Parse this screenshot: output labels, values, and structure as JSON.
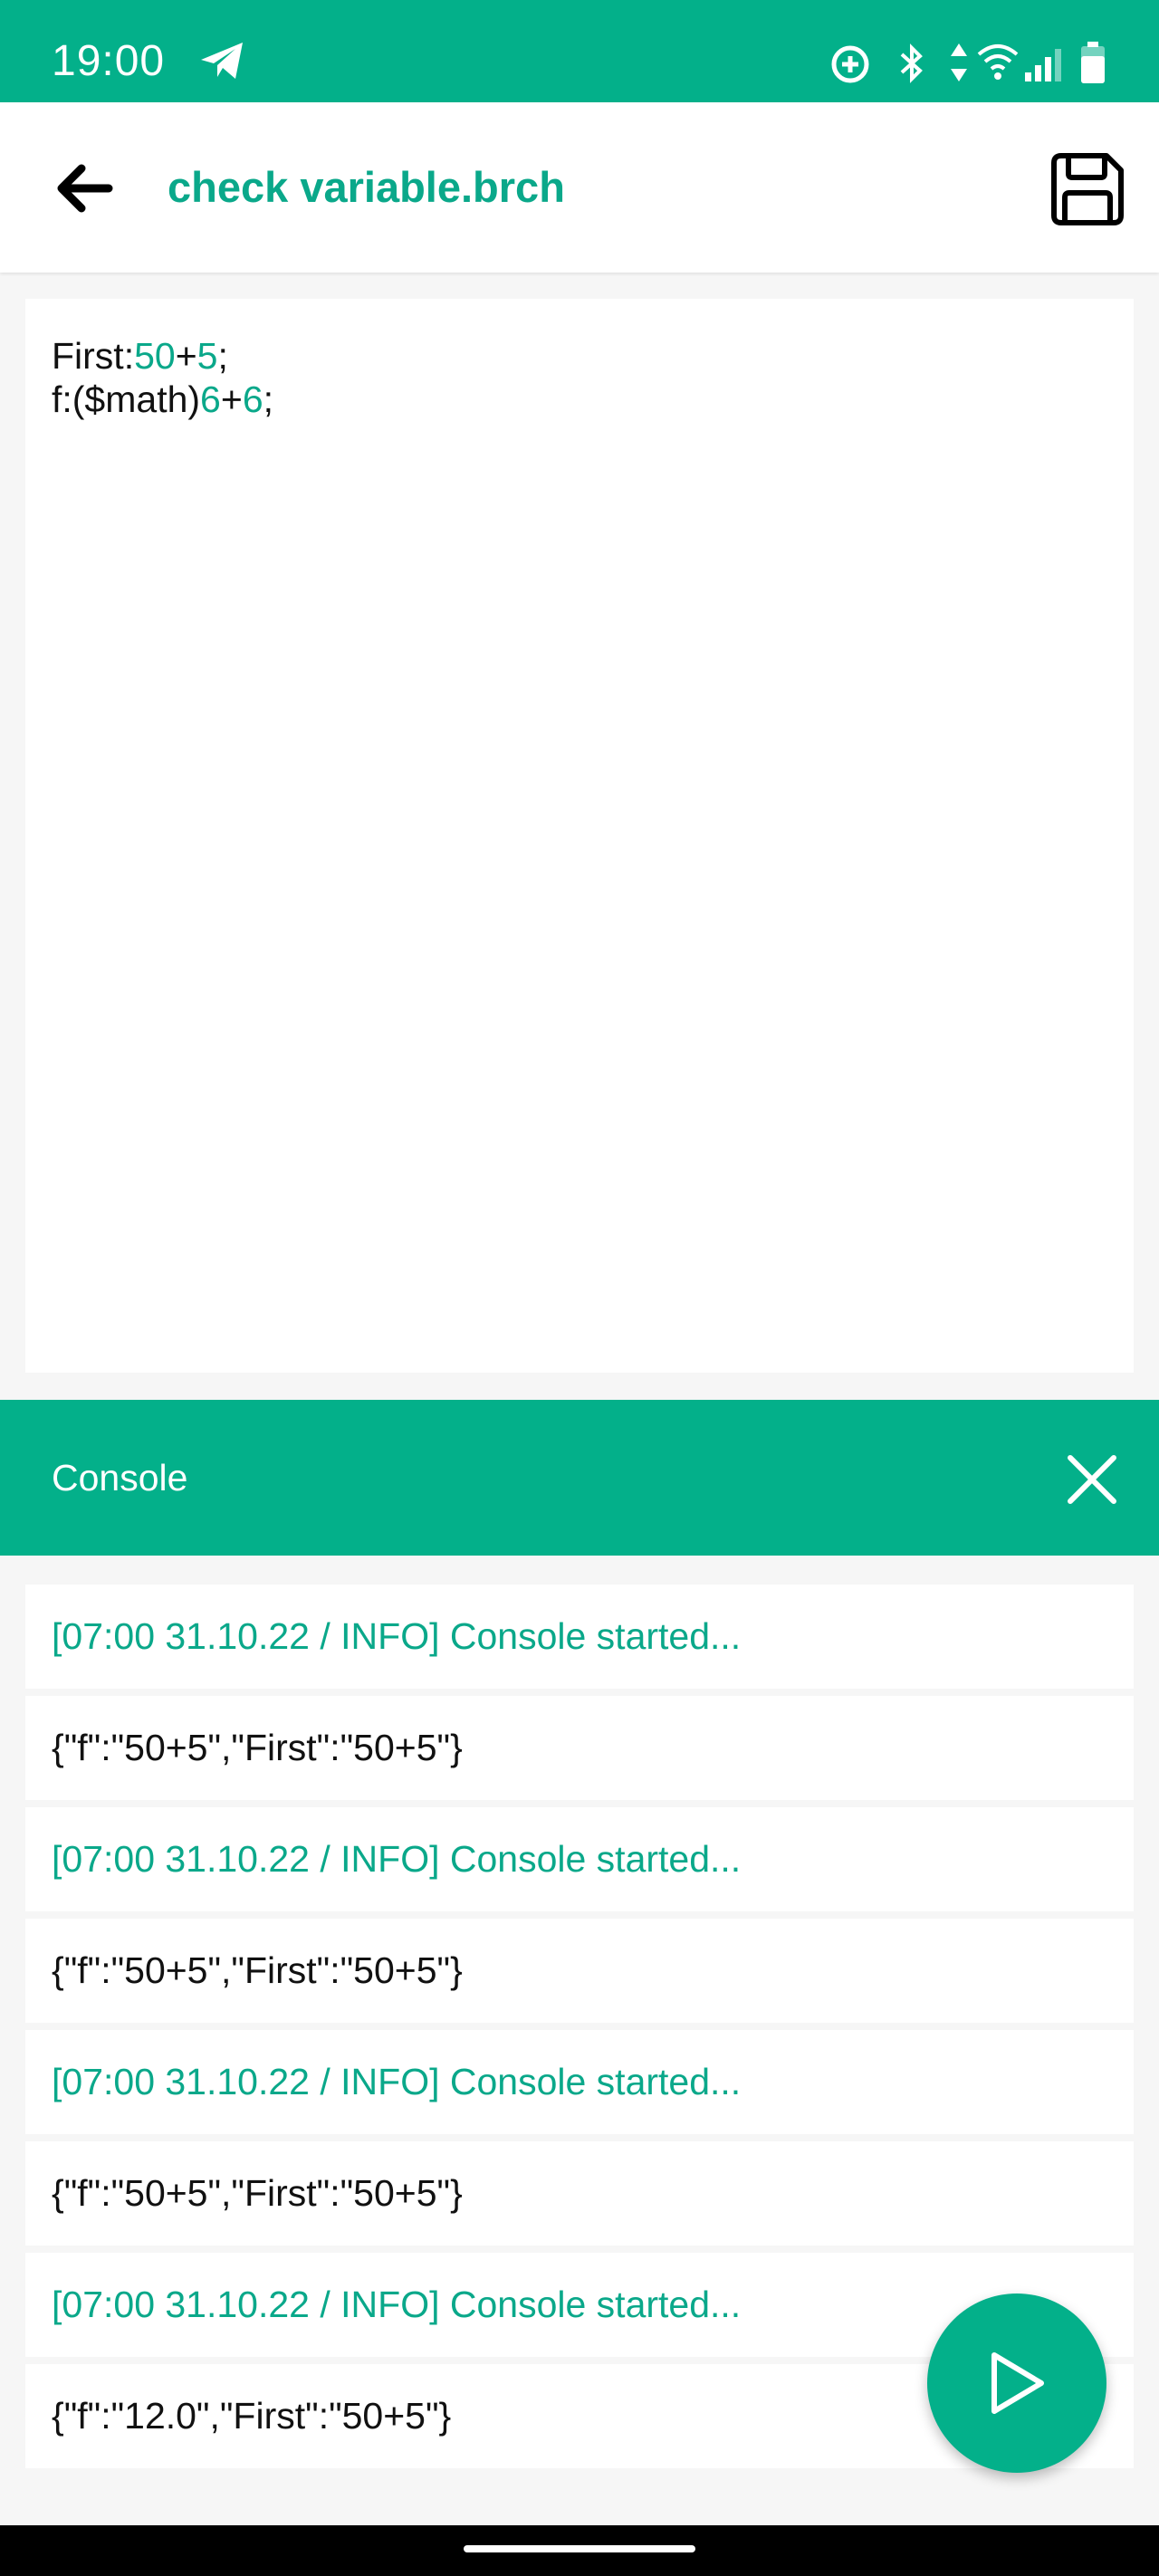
{
  "status_bar": {
    "time": "19:00",
    "icons": [
      "telegram-icon",
      "data-saver-icon",
      "bluetooth-icon",
      "data-arrows-icon",
      "wifi-icon",
      "signal-icon",
      "battery-icon"
    ]
  },
  "app_bar": {
    "title": "check variable.brch",
    "icons": {
      "back": "arrow-left-icon",
      "save": "floppy-disk-icon"
    }
  },
  "editor": {
    "lines": [
      [
        {
          "text": "First:",
          "kind": "plain"
        },
        {
          "text": "50",
          "kind": "num"
        },
        {
          "text": "+",
          "kind": "plain"
        },
        {
          "text": "5",
          "kind": "num"
        },
        {
          "text": ";",
          "kind": "plain"
        }
      ],
      [
        {
          "text": "f:($math)",
          "kind": "plain"
        },
        {
          "text": "6",
          "kind": "num"
        },
        {
          "text": "+",
          "kind": "plain"
        },
        {
          "text": "6",
          "kind": "num"
        },
        {
          "text": ";",
          "kind": "plain"
        }
      ]
    ]
  },
  "console": {
    "title": "Console",
    "close_icon": "close-icon",
    "entries": [
      {
        "kind": "info",
        "text": "[07:00 31.10.22 / INFO] Console started..."
      },
      {
        "kind": "out",
        "text": "{\"f\":\"50+5\",\"First\":\"50+5\"}"
      },
      {
        "kind": "info",
        "text": "[07:00 31.10.22 / INFO] Console started..."
      },
      {
        "kind": "out",
        "text": "{\"f\":\"50+5\",\"First\":\"50+5\"}"
      },
      {
        "kind": "info",
        "text": "[07:00 31.10.22 / INFO] Console started..."
      },
      {
        "kind": "out",
        "text": "{\"f\":\"50+5\",\"First\":\"50+5\"}"
      },
      {
        "kind": "info",
        "text": "[07:00 31.10.22 / INFO] Console started..."
      },
      {
        "kind": "out",
        "text": "{\"f\":\"12.0\",\"First\":\"50+5\"}"
      }
    ]
  },
  "fab": {
    "icon": "play-icon"
  },
  "colors": {
    "accent": "#03b08a",
    "accent_text": "#0aa88a",
    "text": "#111111",
    "background": "#f6f6f6",
    "surface": "#ffffff"
  }
}
